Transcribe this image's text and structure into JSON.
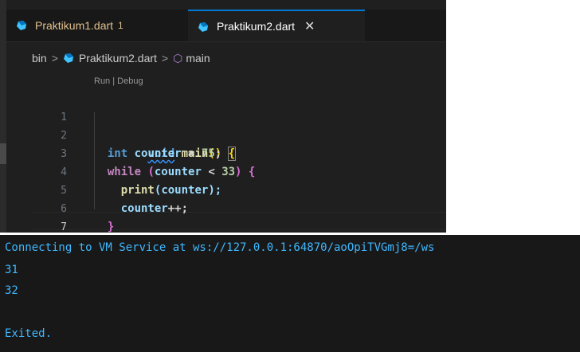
{
  "editor": {
    "tabs": [
      {
        "label": "Praktikum1.dart",
        "badge": "1",
        "active": false
      },
      {
        "label": "Praktikum2.dart",
        "close_glyph": "✕",
        "active": true
      }
    ],
    "breadcrumb": {
      "folder": "bin",
      "separator": ">",
      "file": "Praktikum2.dart",
      "symbol": "main"
    },
    "codelens": "Run | Debug",
    "line_numbers": [
      "1",
      "2",
      "3",
      "4",
      "5",
      "6",
      "7"
    ],
    "code": {
      "l1": {
        "kw": "void",
        "fn": "main",
        "parens": "()",
        "brace": "{"
      },
      "l2": {
        "kw": "int",
        "var": "counter",
        "op": " = ",
        "num": "75",
        "end": ";"
      },
      "l3": {
        "kw": "while",
        "open": " (",
        "var": "counter",
        "op": " < ",
        "num": "33",
        "close": ") ",
        "brace": "{"
      },
      "l4": {
        "fn": "print",
        "open": "(",
        "var": "counter",
        "close": ");"
      },
      "l5": {
        "var": "counter",
        "op": "++;"
      },
      "l6": {
        "brace": "}"
      },
      "l7": {
        "brace": "}"
      }
    },
    "icons": [
      "dart-icon",
      "symbol-method-icon"
    ]
  },
  "terminal": {
    "lines": [
      "Connecting to VM Service at ws://127.0.0.1:64870/aoOpiTVGmj8=/ws",
      "31",
      "32",
      "",
      "Exited."
    ]
  },
  "colors": {
    "editor_bg": "#1f1f1f",
    "terminal_bg": "#181818",
    "terminal_text": "#3fb8ff",
    "active_tab_border": "#0078d4",
    "modified_tab": "#e2c08d"
  }
}
